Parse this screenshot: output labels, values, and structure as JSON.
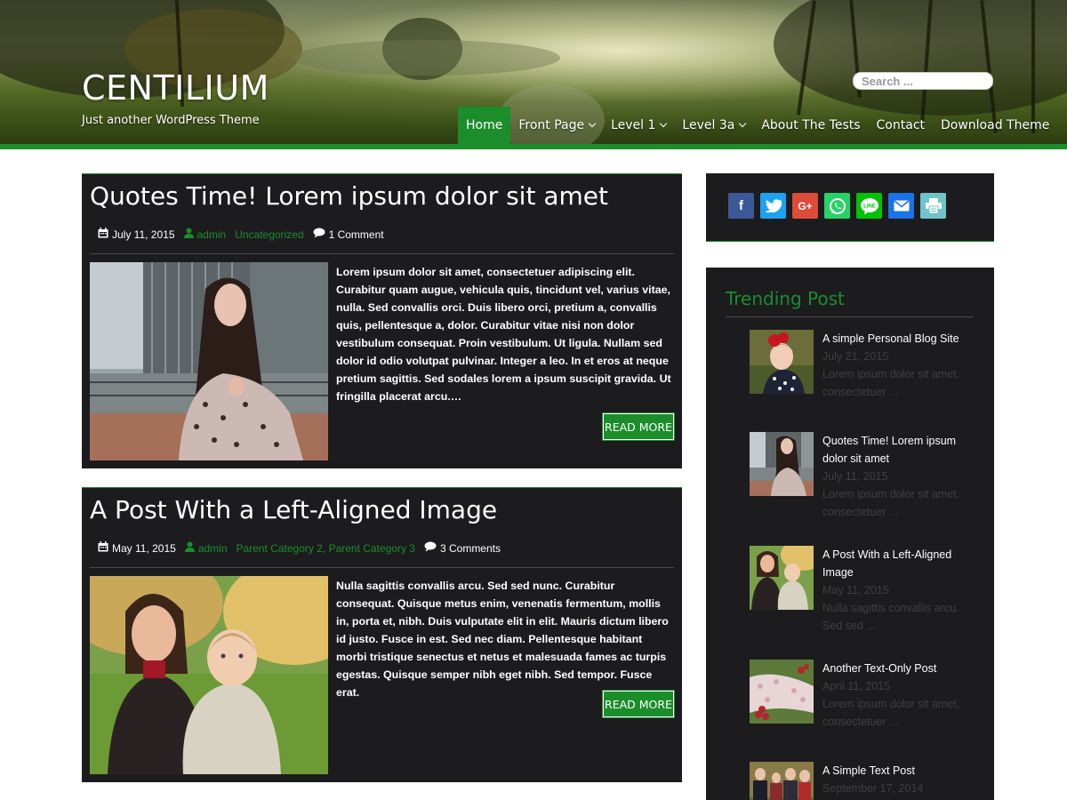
{
  "site": {
    "title": "CENTILIUM",
    "tagline": "Just another WordPress Theme"
  },
  "search": {
    "placeholder": "Search ..."
  },
  "nav": {
    "items": [
      {
        "label": "Home",
        "active": true,
        "has_submenu": false
      },
      {
        "label": "Front Page",
        "active": false,
        "has_submenu": true
      },
      {
        "label": "Level 1",
        "active": false,
        "has_submenu": true
      },
      {
        "label": "Level 3a",
        "active": false,
        "has_submenu": true
      },
      {
        "label": "About The Tests",
        "active": false,
        "has_submenu": false
      },
      {
        "label": "Contact",
        "active": false,
        "has_submenu": false
      },
      {
        "label": "Download Theme",
        "active": false,
        "has_submenu": false
      }
    ]
  },
  "posts": [
    {
      "title": "Quotes Time! Lorem ipsum dolor sit amet",
      "date": "July 11, 2015",
      "author": "admin",
      "categories": [
        "Uncategorized"
      ],
      "comments": "1 Comment",
      "excerpt": "Lorem ipsum dolor sit amet, consectetuer adipiscing elit. Curabitur quam augue, vehicula quis, tincidunt vel, varius vitae, nulla. Sed convallis orci. Duis libero orci, pretium a, convallis quis, pellentesque a, dolor. Curabitur vitae nisi non dolor vestibulum consequat. Proin vestibulum. Ut ligula. Nullam sed dolor id odio volutpat pulvinar. Integer a leo. In et eros at neque pretium sagittis. Sed sodales lorem a ipsum suscipit gravida. Ut fringilla placerat arcu.…",
      "read_more": "READ MORE"
    },
    {
      "title": "A Post With a Left-Aligned Image",
      "date": "May 11, 2015",
      "author": "admin",
      "categories": [
        "Parent Category 2",
        "Parent Category 3"
      ],
      "comments": "3 Comments",
      "excerpt": " Nulla sagittis convallis arcu. Sed sed nunc. Curabitur consequat. Quisque metus enim, venenatis fermentum, mollis in, porta et, nibh. Duis vulputate elit in elit. Mauris dictum libero id justo. Fusce in est. Sed nec diam. Pellentesque habitant morbi tristique senectus et netus et malesuada fames ac turpis egestas. Quisque semper nibh eget nibh. Sed tempor. Fusce erat.",
      "read_more": "READ MORE"
    }
  ],
  "share": [
    {
      "name": "facebook-icon",
      "glyph": "f",
      "color": "#3b5998"
    },
    {
      "name": "twitter-icon",
      "glyph": "🐦",
      "color": "#1da1f2"
    },
    {
      "name": "google-plus-icon",
      "glyph": "G+",
      "color": "#dd4b39"
    },
    {
      "name": "whatsapp-icon",
      "glyph": "✆",
      "color": "#25d366"
    },
    {
      "name": "line-icon",
      "glyph": "LINE",
      "color": "#00c300"
    },
    {
      "name": "email-icon",
      "glyph": "✉",
      "color": "#1a73e8"
    },
    {
      "name": "print-icon",
      "glyph": "⎙",
      "color": "#6fc3c9"
    }
  ],
  "trending": {
    "title": "Trending Post",
    "items": [
      {
        "title": "A simple Personal Blog Site",
        "date": "July 21, 2015",
        "excerpt": "Lorem ipsum dolor sit amet, consectetuer ..."
      },
      {
        "title": "Quotes Time! Lorem ipsum dolor sit amet",
        "date": "July 11, 2015",
        "excerpt": "Lorem ipsum dolor sit amet, consectetuer ..."
      },
      {
        "title": "A Post With a Left-Aligned Image",
        "date": "May 11, 2015",
        "excerpt": " Nulla sagittis convallis arcu. Sed sed ..."
      },
      {
        "title": "Another Text-Only Post",
        "date": "April 11, 2015",
        "excerpt": "Lorem ipsum dolor sit amet, consectetuer ..."
      },
      {
        "title": "A Simple Text Post",
        "date": "September 17, 2014",
        "excerpt": ""
      }
    ]
  },
  "colors": {
    "accent": "#1b8d2b",
    "panel": "#1c1c1e"
  }
}
